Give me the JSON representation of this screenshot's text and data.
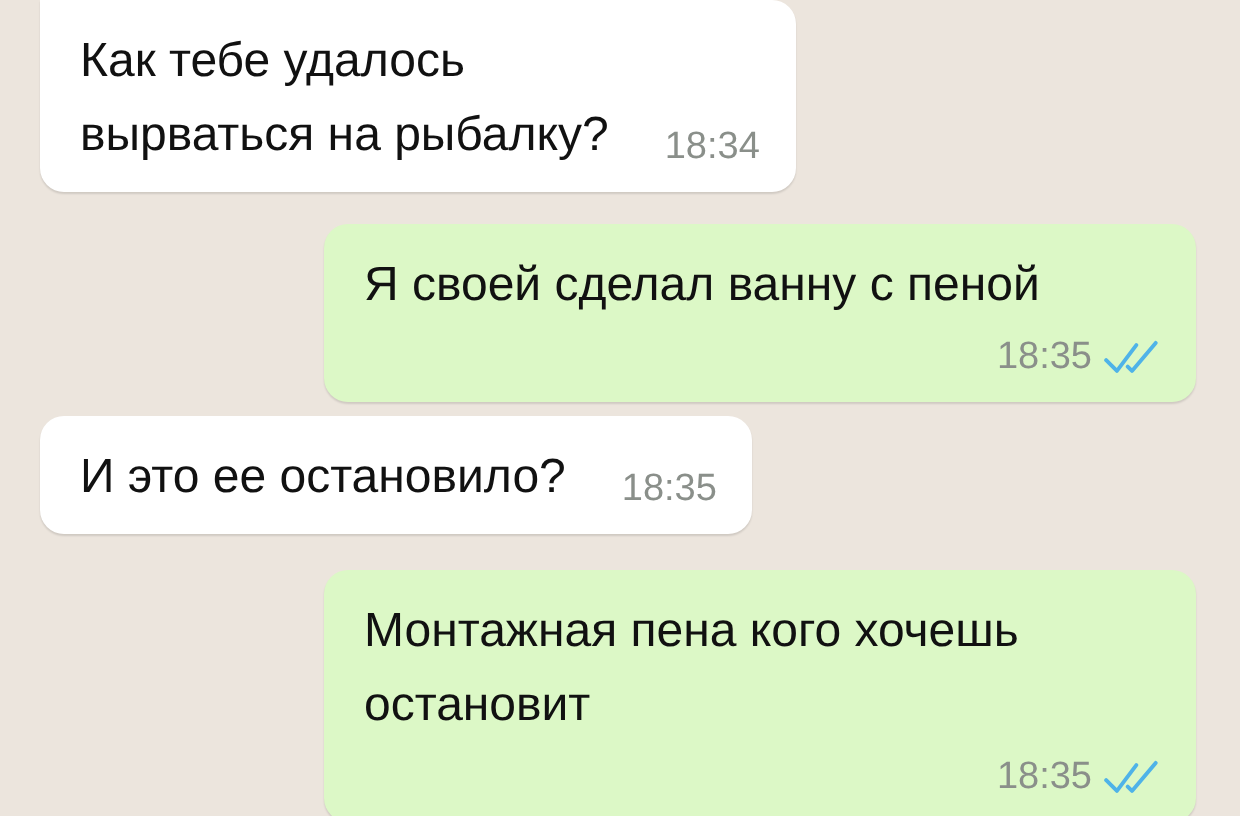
{
  "messages": [
    {
      "kind": "incoming",
      "text": "Как тебе удалось\nвырваться на рыбалку?",
      "time": "18:34"
    },
    {
      "kind": "outgoing",
      "text": "Я своей сделал ванну с пеной",
      "time": "18:35",
      "read": true
    },
    {
      "kind": "incoming",
      "text": "И это ее остановило?",
      "time": "18:35"
    },
    {
      "kind": "outgoing",
      "text": "Монтажная пена кого хочешь\nостановит",
      "time": "18:35",
      "read": true
    }
  ]
}
